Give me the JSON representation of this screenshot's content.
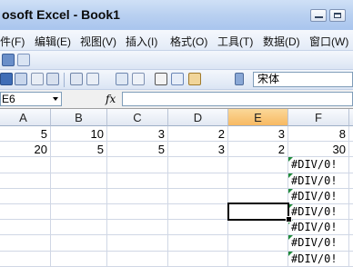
{
  "window": {
    "title": "osoft Excel - Book1"
  },
  "menu": [
    "件(F)",
    "编辑(E)",
    "视图(V)",
    "插入(I)",
    "格式(O)",
    "工具(T)",
    "数据(D)",
    "窗口(W)"
  ],
  "toolbar": {
    "font_name": "宋体"
  },
  "formula_bar": {
    "name_box": "E6",
    "fx_label": "fx"
  },
  "columns": [
    "A",
    "B",
    "C",
    "D",
    "E",
    "F"
  ],
  "active_column": "E",
  "rows": [
    [
      "5",
      "10",
      "3",
      "2",
      "3",
      "8"
    ],
    [
      "20",
      "5",
      "5",
      "3",
      "2",
      "30"
    ],
    [
      "",
      "",
      "",
      "",
      "",
      "#DIV/0!"
    ],
    [
      "",
      "",
      "",
      "",
      "",
      "#DIV/0!"
    ],
    [
      "",
      "",
      "",
      "",
      "",
      "#DIV/0!"
    ],
    [
      "",
      "",
      "",
      "",
      "",
      "#DIV/0!"
    ],
    [
      "",
      "",
      "",
      "",
      "",
      "#DIV/0!"
    ],
    [
      "",
      "",
      "",
      "",
      "",
      "#DIV/0!"
    ],
    [
      "",
      "",
      "",
      "",
      "",
      "#DIV/0!"
    ]
  ],
  "selected_cell": "E6",
  "colors": {
    "active_header": "#f7b962",
    "error_indicator": "#1f8a3a",
    "title_gradient": "#b7cff0"
  }
}
